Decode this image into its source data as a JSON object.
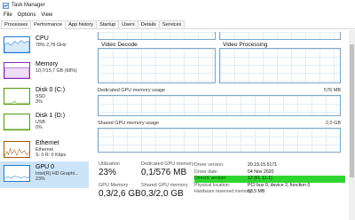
{
  "window": {
    "title": "Task Manager"
  },
  "menu": [
    "File",
    "Options",
    "View"
  ],
  "tabs": [
    "Processes",
    "Performance",
    "App history",
    "Startup",
    "Users",
    "Details",
    "Services"
  ],
  "sidebar": [
    {
      "name": "CPU",
      "sub1": "78%  2,78 GHz",
      "sub2": ""
    },
    {
      "name": "Memory",
      "sub1": "10,7/15,7 GB (68%)",
      "sub2": ""
    },
    {
      "name": "Disk 0 (C:)",
      "sub1": "SSD",
      "sub2": "3%"
    },
    {
      "name": "Disk 1 (D:)",
      "sub1": "USB",
      "sub2": "0%"
    },
    {
      "name": "Ethernet",
      "sub1": "Ethernet",
      "sub2": "S: 0  R: 0 Kbps"
    },
    {
      "name": "GPU 0",
      "sub1": "Intel(R) HD Graphi...",
      "sub2": "23%"
    }
  ],
  "engines": {
    "decode": "Video Decode",
    "processing": "Video Processing"
  },
  "dedicated": {
    "label": "Dedicated GPU memory usage",
    "max": "576 MB"
  },
  "shared": {
    "label": "Shared GPU memory usage",
    "max": "2,0 GB"
  },
  "stats": {
    "utilization": {
      "label": "Utilization",
      "value": "23%"
    },
    "dedicated_mem": {
      "label": "Dedicated GPU memory",
      "value": "0,1/576 MB"
    },
    "gpu_mem": {
      "label": "GPU Memory",
      "value": "0,3/2,6 GB"
    },
    "shared_mem": {
      "label": "Shared GPU memory",
      "value": "0,3/2,0 GB"
    }
  },
  "properties": [
    {
      "k": "Driver version:",
      "v": "20.19.15.5171",
      "highlight": false
    },
    {
      "k": "Driver date:",
      "v": "04 Nov 2020",
      "highlight": false
    },
    {
      "k": "DirectX version:",
      "v": "12 (FL 11.1)",
      "highlight": true
    },
    {
      "k": "Physical location:",
      "v": "PCI bus 0, device 2, function 0",
      "highlight": false
    },
    {
      "k": "Hardware reserved memory:",
      "v": "63,5 MB",
      "highlight": false
    }
  ],
  "colors": {
    "cpu": "#1f7bd1",
    "memory": "#8b2bb9",
    "disk": "#4e9a06",
    "ethernet": "#a55a00",
    "gpu": "#1f7bd1",
    "highlight": "#2fd52f"
  },
  "icons": {
    "app": "task-manager-icon"
  }
}
